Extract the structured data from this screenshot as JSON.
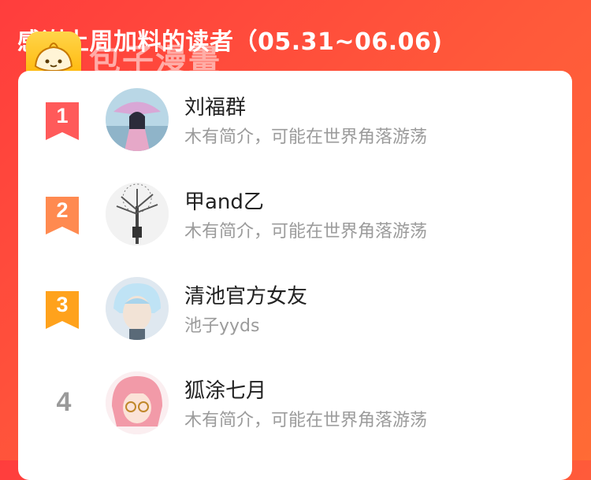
{
  "header": {
    "title": "感谢上周加料的读者（05.31~06.06)"
  },
  "logo": {
    "icon": "bun-icon",
    "text": "包子漫畫"
  },
  "colors": {
    "background_start": "#ff3d3d",
    "background_end": "#ff6b35",
    "rank1": "#ff5a5a",
    "rank2": "#ff8a50",
    "rank3": "#ffa21c",
    "rank_plain": "#9a9a9a"
  },
  "readers": [
    {
      "rank": "1",
      "name": "刘福群",
      "bio": "木有简介，可能在世界角落游荡"
    },
    {
      "rank": "2",
      "name": "甲and乙",
      "bio": "木有简介，可能在世界角落游荡"
    },
    {
      "rank": "3",
      "name": "清池官方女友",
      "bio": "池子yyds"
    },
    {
      "rank": "4",
      "name": "狐涂七月",
      "bio": "木有简介，可能在世界角落游荡"
    }
  ]
}
